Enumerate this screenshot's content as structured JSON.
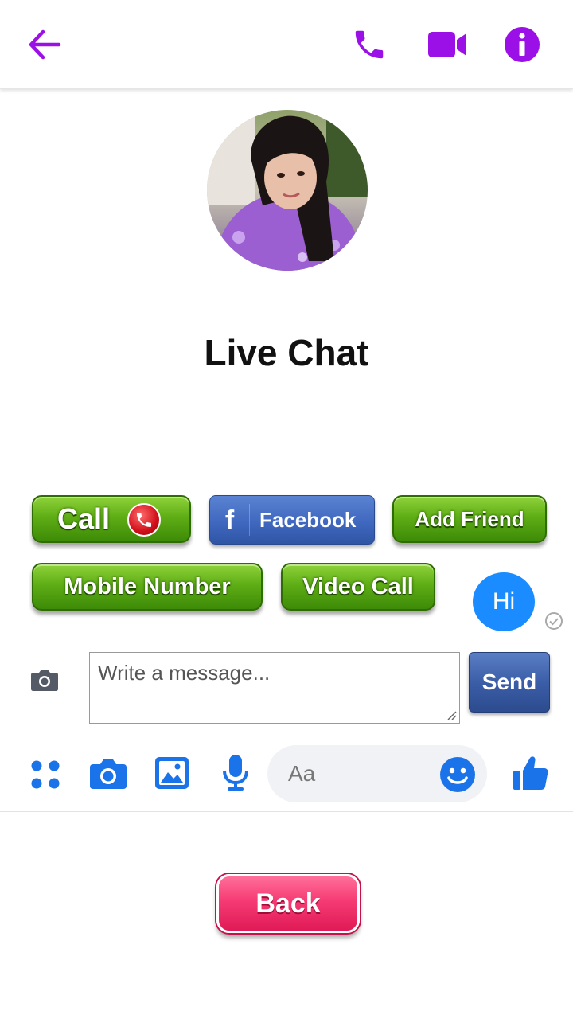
{
  "header": {
    "accent_color": "#9b10e6",
    "icons": [
      "back-arrow-icon",
      "phone-icon",
      "video-camera-icon",
      "info-icon"
    ]
  },
  "profile": {
    "title": "Live Chat"
  },
  "buttons": {
    "call": "Call",
    "facebook_letter": "f",
    "facebook": "Facebook",
    "add_friend": "Add Friend",
    "mobile_number": "Mobile Number",
    "video_call": "Video Call"
  },
  "chat": {
    "bubble_text": "Hi",
    "bubble_color": "#1a8cff"
  },
  "compose": {
    "placeholder": "Write a message...",
    "send_label": "Send"
  },
  "toolbar": {
    "input_placeholder": "Aa",
    "icon_color": "#1a73e8"
  },
  "footer": {
    "back_label": "Back"
  }
}
